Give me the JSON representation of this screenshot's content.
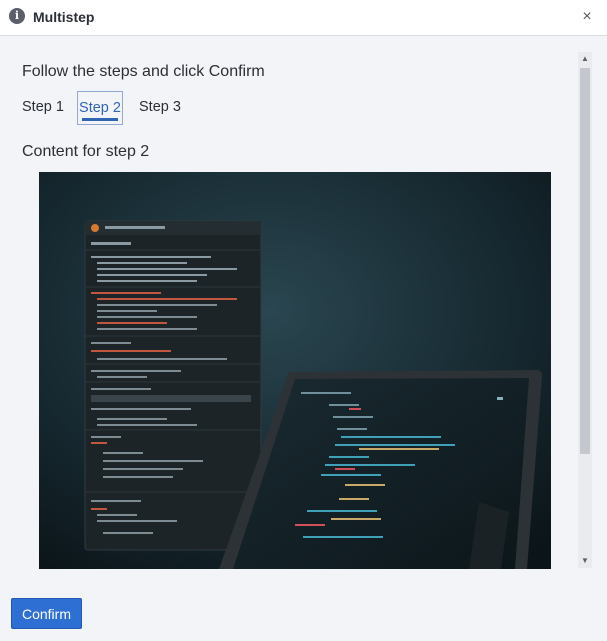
{
  "dialog": {
    "title": "Multistep",
    "title_icon": "info-icon",
    "close_icon": "close-icon",
    "close_glyph": "×"
  },
  "content": {
    "instruction": "Follow the steps and click Confirm",
    "tabs": [
      {
        "label": "Step 1",
        "selected": false
      },
      {
        "label": "Step 2",
        "selected": true
      },
      {
        "label": "Step 3",
        "selected": false
      }
    ],
    "step_heading": "Content for step 2",
    "image": {
      "description_icon": "photo-code-on-laptop"
    }
  },
  "scrollbar": {
    "up_glyph": "▲",
    "down_glyph": "▼"
  },
  "footer": {
    "confirm_label": "Confirm"
  },
  "colors": {
    "accent": "#2e6fd4",
    "tab_selected": "#2f66b3",
    "background": "#f3f4f7"
  }
}
